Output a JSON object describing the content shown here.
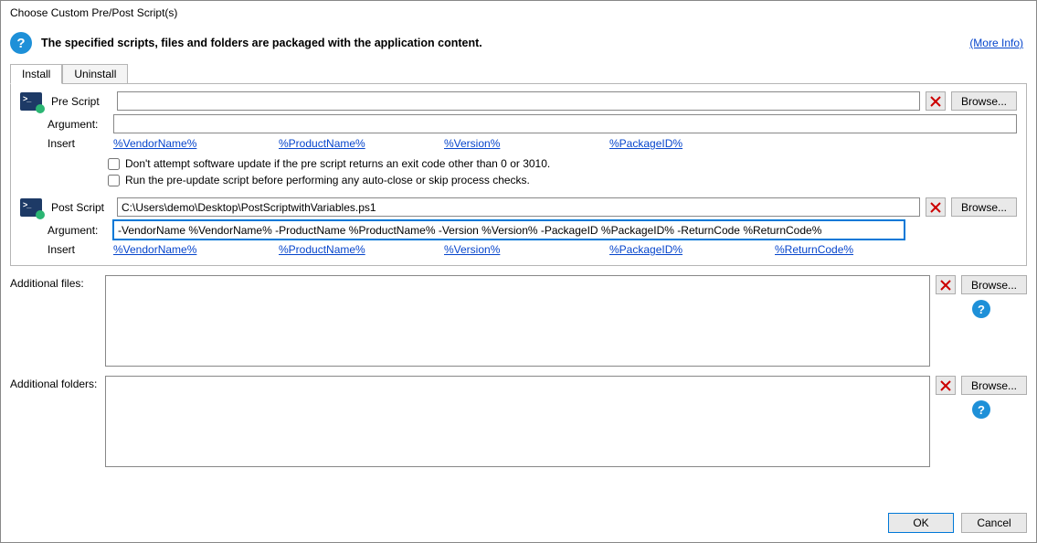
{
  "window": {
    "title": "Choose Custom Pre/Post Script(s)"
  },
  "banner": {
    "message": "The specified scripts, files and folders are packaged with the application content.",
    "more_info": "(More Info)"
  },
  "tabs": {
    "install": "Install",
    "uninstall": "Uninstall"
  },
  "labels": {
    "pre_script": "Pre Script",
    "post_script": "Post Script",
    "argument": "Argument:",
    "insert": "Insert",
    "additional_files": "Additional files:",
    "additional_folders": "Additional folders:",
    "browse": "Browse...",
    "ok": "OK",
    "cancel": "Cancel"
  },
  "pre_script": {
    "path": "",
    "argument": "",
    "insert_vars": [
      "%VendorName%",
      "%ProductName%",
      "%Version%",
      "%PackageID%"
    ],
    "check1": "Don't attempt software update if the pre script returns an exit code other than 0 or 3010.",
    "check2": "Run the pre-update script before performing any auto-close or skip process checks."
  },
  "post_script": {
    "path": "C:\\Users\\demo\\Desktop\\PostScriptwithVariables.ps1",
    "argument": "-VendorName %VendorName% -ProductName %ProductName% -Version %Version% -PackageID %PackageID% -ReturnCode %ReturnCode%",
    "insert_vars": [
      "%VendorName%",
      "%ProductName%",
      "%Version%",
      "%PackageID%",
      "%ReturnCode%"
    ]
  },
  "additional_files": "",
  "additional_folders": ""
}
